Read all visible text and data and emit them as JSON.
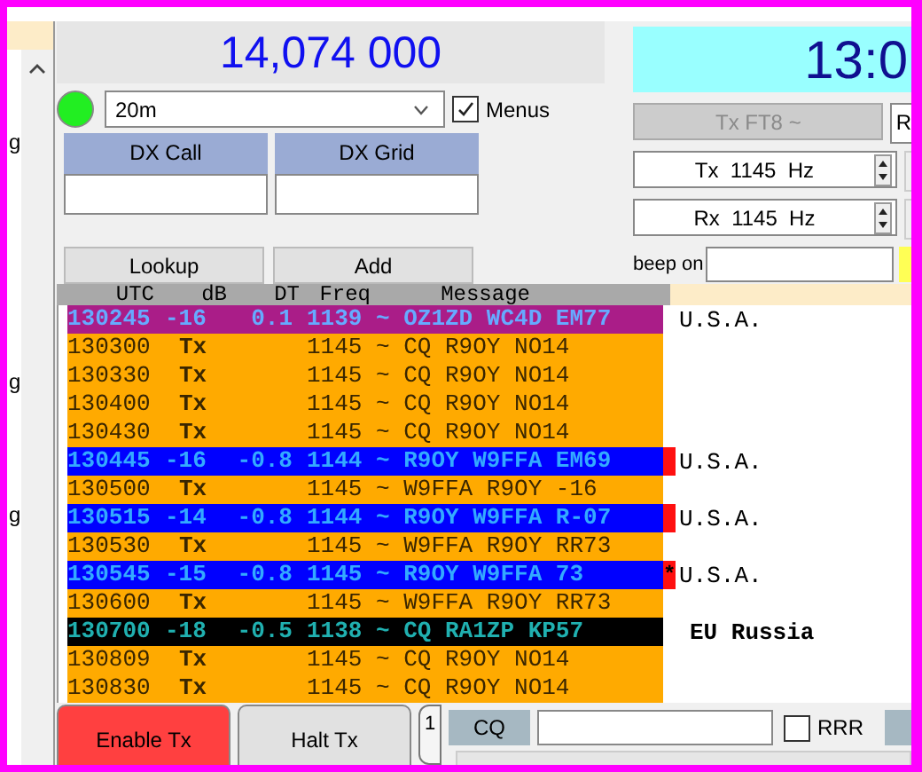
{
  "left_panel": {
    "fragments": [
      "g",
      "g",
      "g"
    ]
  },
  "frequency": "14,074 000",
  "band": {
    "value": "20m"
  },
  "menus": {
    "label": "Menus",
    "checked": true
  },
  "dx_fields": [
    {
      "label": "DX Call"
    },
    {
      "label": "DX Grid"
    }
  ],
  "lookup_buttons": [
    "Lookup",
    "Add"
  ],
  "clock": "13:0",
  "tx_mode": {
    "label": "Tx FT8 ~",
    "disabled": true
  },
  "side_button": "R",
  "spinboxes": [
    {
      "value": "Tx  1145  Hz"
    },
    {
      "value": "Rx  1145  Hz"
    }
  ],
  "beep_on": {
    "label": "beep on"
  },
  "decodes": {
    "columns": [
      "UTC",
      "dB",
      "DT",
      "Freq",
      "Message"
    ],
    "rows": [
      {
        "kind": "highlight",
        "utc": "130245",
        "db": "-16",
        "dt": "0.1",
        "freq": "1139",
        "message": "~ OZ1ZD WC4D EM77",
        "flag": false,
        "country": "U.S.A."
      },
      {
        "kind": "tx",
        "utc": "130300",
        "db": "Tx",
        "freq": "1145",
        "message": "~ CQ R9OY NO14",
        "flag": false
      },
      {
        "kind": "tx",
        "utc": "130330",
        "db": "Tx",
        "freq": "1145",
        "message": "~ CQ R9OY NO14",
        "flag": false
      },
      {
        "kind": "tx",
        "utc": "130400",
        "db": "Tx",
        "freq": "1145",
        "message": "~ CQ R9OY NO14",
        "flag": false
      },
      {
        "kind": "tx",
        "utc": "130430",
        "db": "Tx",
        "freq": "1145",
        "message": "~ CQ R9OY NO14",
        "flag": false
      },
      {
        "kind": "rx",
        "utc": "130445",
        "db": "-16",
        "dt": "-0.8",
        "freq": "1144",
        "message": "~ R9OY W9FFA EM69",
        "flag": true,
        "country": "U.S.A."
      },
      {
        "kind": "tx",
        "utc": "130500",
        "db": "Tx",
        "freq": "1145",
        "message": "~ W9FFA R9OY -16",
        "flag": false
      },
      {
        "kind": "rx",
        "utc": "130515",
        "db": "-14",
        "dt": "-0.8",
        "freq": "1144",
        "message": "~ R9OY W9FFA R-07",
        "flag": true,
        "country": "U.S.A."
      },
      {
        "kind": "tx",
        "utc": "130530",
        "db": "Tx",
        "freq": "1145",
        "message": "~ W9FFA R9OY RR73",
        "flag": false
      },
      {
        "kind": "rx",
        "utc": "130545",
        "db": "-15",
        "dt": "-0.8",
        "freq": "1145",
        "message": "~ R9OY W9FFA 73",
        "flag": true,
        "flag_text": "*",
        "country": "U.S.A."
      },
      {
        "kind": "tx",
        "utc": "130600",
        "db": "Tx",
        "freq": "1145",
        "message": "~ W9FFA R9OY RR73",
        "flag": false
      },
      {
        "kind": "cq",
        "utc": "130700",
        "db": "-18",
        "dt": "-0.5",
        "freq": "1138",
        "message": "~ CQ RA1ZP KP57",
        "flag": false,
        "country": "EU Russia"
      },
      {
        "kind": "tx",
        "utc": "130809",
        "db": "Tx",
        "freq": "1145",
        "message": "~ CQ R9OY NO14",
        "flag": false
      },
      {
        "kind": "tx",
        "utc": "130830",
        "db": "Tx",
        "freq": "1145",
        "message": "~ CQ R9OY NO14",
        "flag": false
      }
    ]
  },
  "enable_tx": {
    "label": "Enable Tx",
    "on": true
  },
  "halt_tx": {
    "label": "Halt Tx"
  },
  "tab": {
    "label": "1"
  },
  "cq": {
    "label": "CQ"
  },
  "rrr": {
    "label": "RRR",
    "checked": false
  }
}
